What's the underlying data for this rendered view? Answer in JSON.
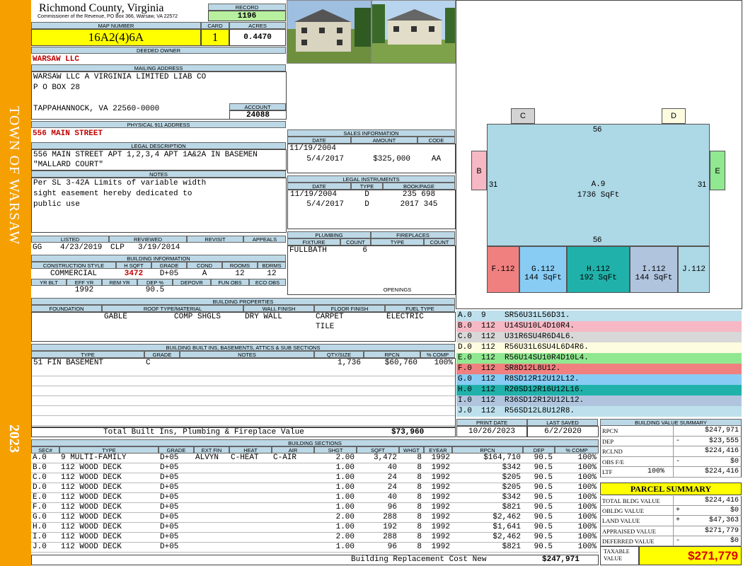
{
  "header": {
    "county": "Richmond County, Virginia",
    "commissioner": "Commissioner of the Revenue, PO Box 366, Warsaw, VA 22572"
  },
  "record": {
    "label": "RECORD",
    "value": "1196"
  },
  "map": {
    "label": "MAP NUMBER",
    "value": "16A2(4)6A",
    "card_label": "CARD",
    "card": "1",
    "acres_label": "ACRES",
    "acres": "0.4470"
  },
  "owner": {
    "label": "DEEDED OWNER",
    "value": "WARSAW LLC"
  },
  "mailing": {
    "label": "MAILING ADDRESS",
    "line1": "WARSAW LLC A VIRGINIA LIMITED LIAB CO",
    "line2": "P O BOX 28",
    "line3": "TAPPAHANNOCK, VA 22560-0000"
  },
  "account": {
    "label": "ACCOUNT",
    "value": "24088"
  },
  "physical": {
    "label": "PHYSICAL 911 ADDRESS",
    "value": "556 MAIN STREET"
  },
  "legal": {
    "label": "LEGAL DESCRIPTION",
    "line1": "556 MAIN STREET APT 1,2,3,4 APT 1A&2A IN BASEMEN",
    "line2": "\"MALLARD COURT\""
  },
  "notes": {
    "label": "NOTES",
    "line1": "Per SL 3-42A Limits of variable width",
    "line2": "sight easement hereby dedicated to",
    "line3": "public use"
  },
  "sidebar": {
    "town": "TOWN OF WARSAW",
    "year": "2023"
  },
  "sales": {
    "label": "SALES INFORMATION",
    "cols": [
      "DATE",
      "AMOUNT",
      "CODE"
    ],
    "rows": [
      [
        "11/19/2004",
        "",
        ""
      ],
      [
        "5/4/2017",
        "$325,000",
        "AA"
      ]
    ]
  },
  "instruments": {
    "label": "LEGAL INSTRUMENTS",
    "cols": [
      "DATE",
      "TYPE",
      "BOOK/PAGE"
    ],
    "rows": [
      [
        "11/19/2004",
        "D",
        "235 698"
      ],
      [
        "5/4/2017",
        "D",
        "2017 345"
      ]
    ]
  },
  "plumbing": {
    "label": "PLUMBING",
    "cols": [
      "FIXTURE",
      "COUNT"
    ],
    "rows": [
      [
        "FULLBATH",
        "6"
      ]
    ]
  },
  "fireplaces": {
    "label": "FIREPLACES",
    "cols": [
      "TYPE",
      "COUNT"
    ],
    "openings": "OPENINGS"
  },
  "listing": {
    "cols": [
      "LISTED",
      "REVIEWED",
      "REVISIT",
      "APPEALS"
    ],
    "listed_by": "GG",
    "listed": "4/23/2019",
    "reviewed_by": "CLP",
    "reviewed": "3/19/2014"
  },
  "building_info": {
    "label": "BUILDING INFORMATION",
    "cols": [
      "CONSTRUCTION STYLE",
      "H SQFT",
      "GRADE",
      "COND",
      "ROOMS",
      "BDRMS"
    ],
    "values": [
      "COMMERCIAL",
      "3472",
      "D+05",
      "A",
      "12",
      "12"
    ],
    "cols2": [
      "YR BLT",
      "EFF YR",
      "REM YR",
      "DEP %",
      "DEPOVR",
      "FUN OBS",
      "ECO OBS"
    ],
    "values2": [
      "",
      "1992",
      "",
      "90.5",
      "",
      "",
      ""
    ]
  },
  "properties": {
    "label": "BUILDING PROPERTIES",
    "cols": [
      "FOUNDATION",
      "ROOF TYPE/MATERIAL",
      "WALL FINISH",
      "FLOOR FINISH",
      "FUEL TYPE"
    ],
    "roof_type": "GABLE",
    "roof_material": "COMP SHGLS",
    "wall": "DRY WALL",
    "floor1": "CARPET",
    "floor2": "TILE",
    "fuel": "ELECTRIC"
  },
  "builtins": {
    "label": "BUILDING BUILT INS, BASEMENTS, ATTICS & SUB SECTIONS",
    "cols": [
      "TYPE",
      "GRADE",
      "NOTES",
      "QTY/SIZE",
      "RPCN",
      "% COMP"
    ],
    "row": [
      "51 FIN BASEMENT",
      "C",
      "",
      "1,736",
      "$60,760",
      "100%"
    ],
    "total_label": "Total Built Ins, Plumbing & Fireplace Value",
    "total": "$73,960"
  },
  "dates": {
    "print_label": "PRINT DATE",
    "print": "10/26/2023",
    "saved_label": "LAST SAVED",
    "saved": "6/2/2020"
  },
  "sections": {
    "label": "BUILDING SECTIONS",
    "cols": [
      "SEC#",
      "TYPE",
      "GRADE",
      "EXT FIN",
      "HEAT",
      "AIR",
      "SHGT",
      "SQFT",
      "WHGT",
      "EYEAR",
      "RPCN",
      "DEP",
      "% COMP"
    ],
    "rows": [
      [
        "A.0",
        "9 MULTI-FAMILY",
        "D+05",
        "ALVYN",
        "C-HEAT",
        "C-AIR",
        "2.00",
        "3,472",
        "8",
        "1992",
        "$164,710",
        "90.5",
        "100%"
      ],
      [
        "B.0",
        "112 WOOD DECK",
        "D+05",
        "",
        "",
        "",
        "1.00",
        "40",
        "8",
        "1992",
        "$342",
        "90.5",
        "100%"
      ],
      [
        "C.0",
        "112 WOOD DECK",
        "D+05",
        "",
        "",
        "",
        "1.00",
        "24",
        "8",
        "1992",
        "$205",
        "90.5",
        "100%"
      ],
      [
        "D.0",
        "112 WOOD DECK",
        "D+05",
        "",
        "",
        "",
        "1.00",
        "24",
        "8",
        "1992",
        "$205",
        "90.5",
        "100%"
      ],
      [
        "E.0",
        "112 WOOD DECK",
        "D+05",
        "",
        "",
        "",
        "1.00",
        "40",
        "8",
        "1992",
        "$342",
        "90.5",
        "100%"
      ],
      [
        "F.0",
        "112 WOOD DECK",
        "D+05",
        "",
        "",
        "",
        "1.00",
        "96",
        "8",
        "1992",
        "$821",
        "90.5",
        "100%"
      ],
      [
        "G.0",
        "112 WOOD DECK",
        "D+05",
        "",
        "",
        "",
        "2.00",
        "288",
        "8",
        "1992",
        "$2,462",
        "90.5",
        "100%"
      ],
      [
        "H.0",
        "112 WOOD DECK",
        "D+05",
        "",
        "",
        "",
        "1.00",
        "192",
        "8",
        "1992",
        "$1,641",
        "90.5",
        "100%"
      ],
      [
        "I.0",
        "112 WOOD DECK",
        "D+05",
        "",
        "",
        "",
        "2.00",
        "288",
        "8",
        "1992",
        "$2,462",
        "90.5",
        "100%"
      ],
      [
        "J.0",
        "112 WOOD DECK",
        "D+05",
        "",
        "",
        "",
        "1.00",
        "96",
        "8",
        "1992",
        "$821",
        "90.5",
        "100%"
      ]
    ],
    "total_label": "Building Replacement Cost New",
    "total": "$247,971"
  },
  "sketch": {
    "A_label": "A.9",
    "A_area": "1736 SqFt",
    "top": "56",
    "bottom": "56",
    "left": "31",
    "right": "31",
    "B": "B",
    "C": "C",
    "D": "D",
    "E": "E",
    "F": "F.112",
    "G": "G.112",
    "G_area": "144 SqFt",
    "H": "H.112",
    "H_area": "192 SqFt",
    "I": "I.112",
    "I_area": "144 SqFt",
    "J": "J.112"
  },
  "segments": [
    {
      "text": "A.0  9    SR56U31L56D31.",
      "color": "#bde0ec"
    },
    {
      "text": "B.0  112  U14SU10L4D10R4.",
      "color": "#f6b8c4"
    },
    {
      "text": "C.0  112  U31R6SU4R6D4L6.",
      "color": "#d8d8d8"
    },
    {
      "text": "D.0  112  R56U31L6SU4L6D4R6.",
      "color": "#fdfbe0"
    },
    {
      "text": "E.0  112  R56U14SU10R4D10L4.",
      "color": "#90e890"
    },
    {
      "text": "F.0  112  SR8D12L8U12.",
      "color": "#f08080"
    },
    {
      "text": "G.0  112  R8SD12R12U12L12.",
      "color": "#88ccf4"
    },
    {
      "text": "H.0  112  R20SD12R16U12L16.",
      "color": "#20b2aa"
    },
    {
      "text": "I.0  112  R36SD12R12U12L12.",
      "color": "#b0c4de"
    },
    {
      "text": "J.0  112  R56SD12L8U12R8.",
      "color": "#bde0ec"
    }
  ],
  "value_summary": {
    "label": "BUILDING VALUE SUMMARY",
    "rows": [
      {
        "k": "RPCN",
        "s": "",
        "v": "$247,971"
      },
      {
        "k": "DEP",
        "s": "-",
        "v": "$23,555"
      },
      {
        "k": "RCLND",
        "s": "",
        "v": "$224,416"
      },
      {
        "k": "OBS F/E",
        "s": "-",
        "v": "$0"
      },
      {
        "k": "LTF",
        "p": "100%",
        "s": "",
        "v": "$224,416"
      }
    ]
  },
  "parcel": {
    "title": "PARCEL SUMMARY",
    "rows": [
      {
        "k": "TOTAL BLDG VALUE",
        "s": "",
        "v": "$224,416"
      },
      {
        "k": "OBLDG VALUE",
        "s": "+",
        "v": "$0"
      },
      {
        "k": "LAND VALUE",
        "s": "+",
        "v": "$47,363"
      },
      {
        "k": "APPRAISED VALUE",
        "s": "",
        "v": "$271,779"
      },
      {
        "k": "DEFERRED VALUE",
        "s": "-",
        "v": "$0"
      }
    ],
    "taxable_label": "TAXABLE VALUE",
    "taxable": "$271,779"
  },
  "colors": {
    "sidebar": "#f5a000",
    "header": "#bcd8e6",
    "yellow": "#ffff00",
    "record_green": "#b8f0a0"
  }
}
